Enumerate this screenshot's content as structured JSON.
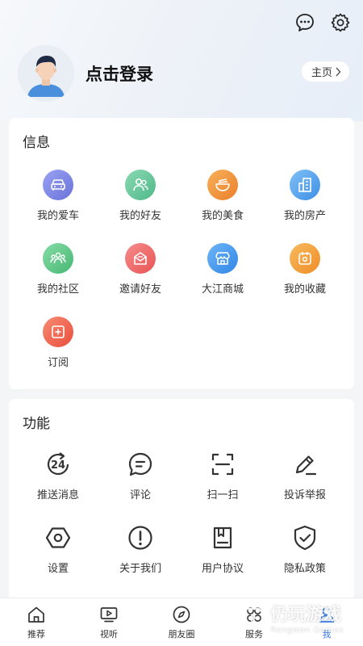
{
  "header": {
    "icons": [
      "message-icon",
      "settings-icon"
    ],
    "login_text": "点击登录",
    "homepage_label": "主页"
  },
  "info_section": {
    "title": "信息",
    "items": [
      {
        "label": "我的爱车",
        "icon": "car-icon",
        "color": "#7a86e6"
      },
      {
        "label": "我的好友",
        "icon": "friends-icon",
        "color": "#62c79a"
      },
      {
        "label": "我的美食",
        "icon": "food-icon",
        "color": "#f19a40"
      },
      {
        "label": "我的房产",
        "icon": "building-icon",
        "color": "#5aa8f0"
      },
      {
        "label": "我的社区",
        "icon": "community-icon",
        "color": "#5dc384"
      },
      {
        "label": "邀请好友",
        "icon": "invite-icon",
        "color": "#f06b6b"
      },
      {
        "label": "大江商城",
        "icon": "store-icon",
        "color": "#4a9df0"
      },
      {
        "label": "我的收藏",
        "icon": "favorite-icon",
        "color": "#f3a23e"
      },
      {
        "label": "订阅",
        "icon": "subscribe-icon",
        "color": "#f26b57"
      }
    ]
  },
  "function_section": {
    "title": "功能",
    "items": [
      {
        "label": "推送消息",
        "icon": "push-24-icon",
        "badge_text": "24"
      },
      {
        "label": "评论",
        "icon": "comment-icon"
      },
      {
        "label": "扫一扫",
        "icon": "scan-icon"
      },
      {
        "label": "投诉举报",
        "icon": "edit-report-icon"
      },
      {
        "label": "设置",
        "icon": "hexagon-settings-icon"
      },
      {
        "label": "关于我们",
        "icon": "info-icon"
      },
      {
        "label": "用户协议",
        "icon": "document-icon"
      },
      {
        "label": "隐私政策",
        "icon": "shield-check-icon"
      }
    ]
  },
  "tabbar": {
    "tabs": [
      {
        "label": "推荐",
        "icon": "home-icon"
      },
      {
        "label": "视听",
        "icon": "video-icon"
      },
      {
        "label": "朋友圈",
        "icon": "compass-icon"
      },
      {
        "label": "服务",
        "icon": "grid-icon"
      },
      {
        "label": "我",
        "icon": "user-icon",
        "active": true
      }
    ],
    "active_color": "#3d7be0"
  },
  "watermark": {
    "text": "仍玩游戏",
    "subtext": "Rengwan Games"
  }
}
